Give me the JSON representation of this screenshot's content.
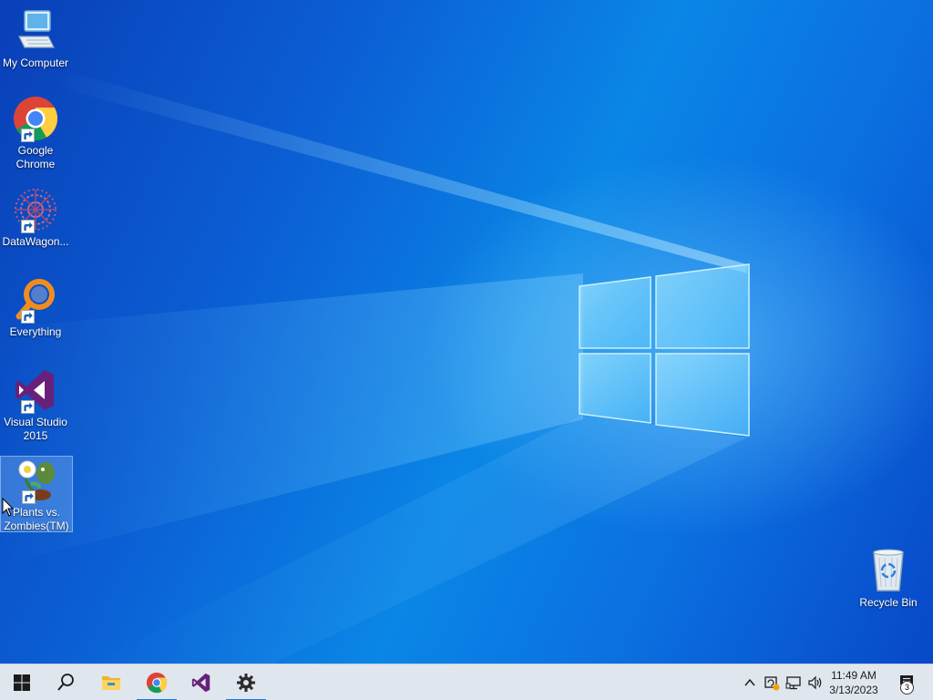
{
  "desktop": {
    "icons": [
      {
        "label": "My Computer",
        "icon": "computer-icon"
      },
      {
        "label": "Google Chrome",
        "icon": "chrome-icon"
      },
      {
        "label": "DataWagon...",
        "icon": "datawagon-icon"
      },
      {
        "label": "Everything",
        "icon": "everything-search-icon"
      },
      {
        "label": "Visual Studio 2015",
        "icon": "visual-studio-icon"
      },
      {
        "label": "Plants vs. Zombies(TM)",
        "icon": "plants-vs-zombies-icon"
      },
      {
        "label": "Recycle Bin",
        "icon": "recycle-bin-icon"
      }
    ],
    "selected_icon": "Plants vs. Zombies(TM)"
  },
  "taskbar": {
    "buttons": [
      {
        "name": "start",
        "icon": "windows-start-icon"
      },
      {
        "name": "search",
        "icon": "search-icon"
      },
      {
        "name": "file-explorer",
        "icon": "folder-icon"
      },
      {
        "name": "chrome",
        "icon": "chrome-icon"
      },
      {
        "name": "visual-studio",
        "icon": "visual-studio-icon"
      },
      {
        "name": "settings",
        "icon": "gear-icon"
      }
    ],
    "tray": {
      "icons": [
        "chevron-up-icon",
        "security-alert-icon",
        "network-icon",
        "volume-icon"
      ],
      "time": "11:49 AM",
      "date": "3/13/2023",
      "notification_count": "3"
    }
  },
  "colors": {
    "accent": "#1c7bd9",
    "taskbar_bg": "#dfe6ee",
    "wallpaper_primary": "#0b5fd4"
  }
}
